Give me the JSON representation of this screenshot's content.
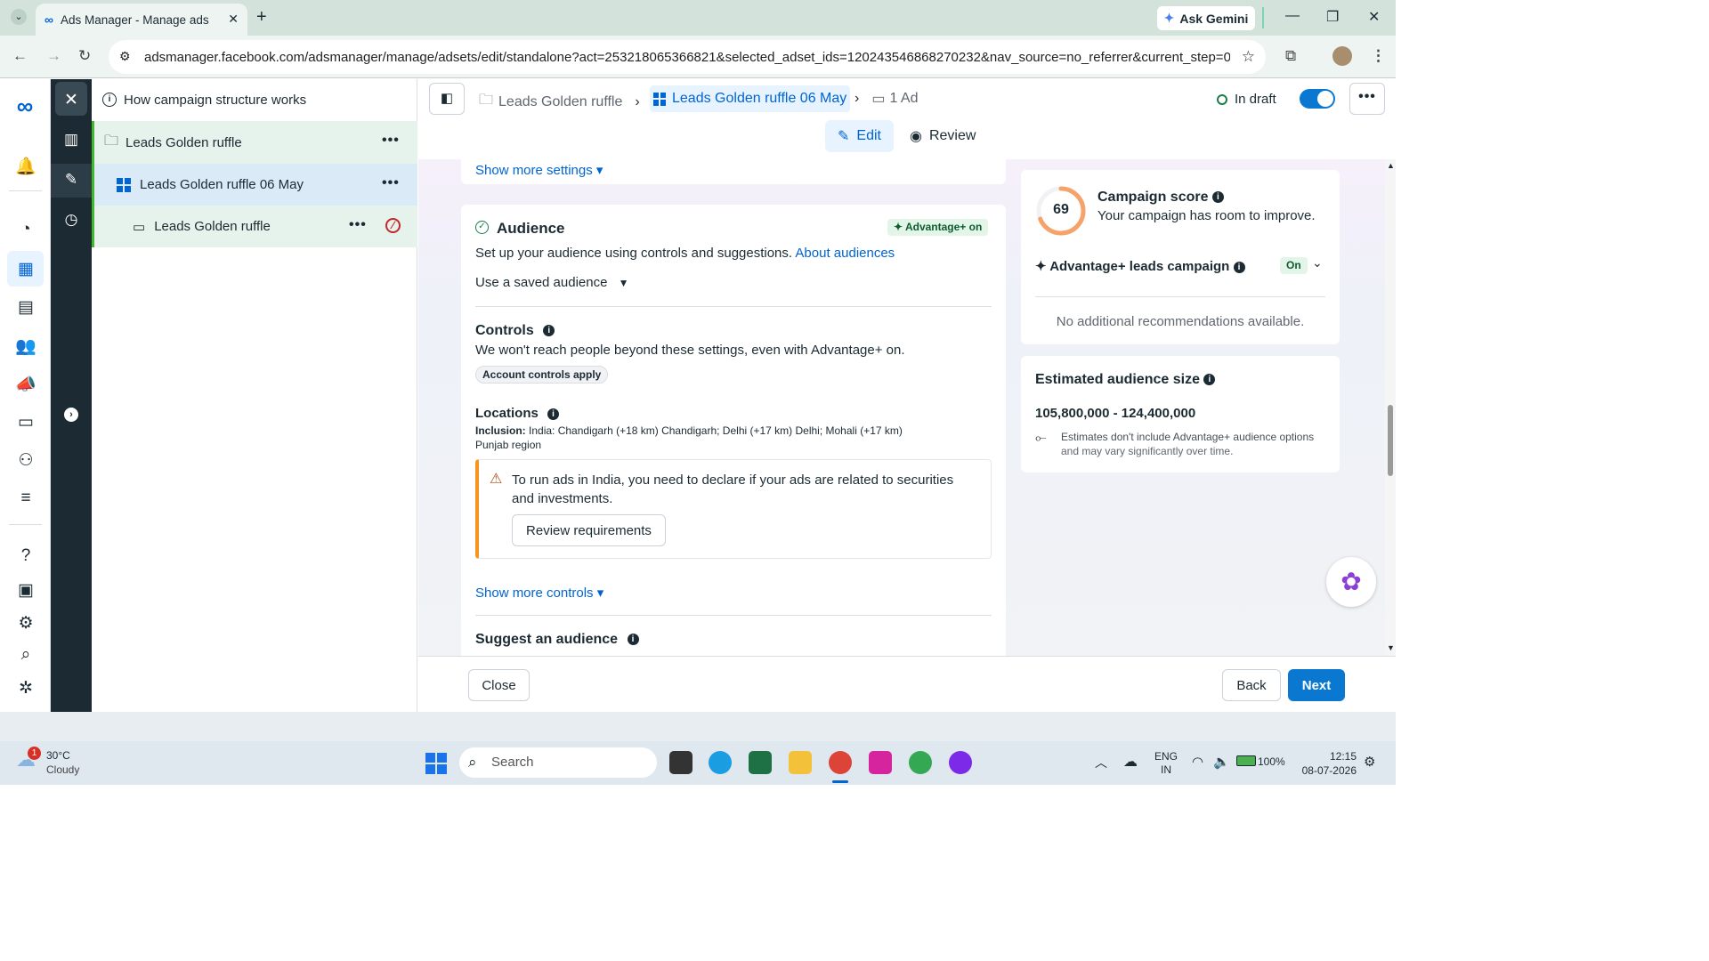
{
  "browser": {
    "tab_title": "Ads Manager - Manage ads - A",
    "ask_gemini": "Ask Gemini",
    "url": "adsmanager.facebook.com/adsmanager/manage/adsets/edit/standalone?act=253218065366821&selected_adset_ids=120243546868270232&nav_source=no_referrer&current_step=0"
  },
  "tree": {
    "header": "How campaign structure works",
    "campaign": "Leads Golden ruffle",
    "adset": "Leads Golden ruffle 06 May",
    "ad": "Leads Golden ruffle"
  },
  "topbar": {
    "crumb_campaign": "Leads Golden ruffle",
    "crumb_adset": "Leads Golden ruffle 06 May",
    "crumb_ad": "1 Ad",
    "status": "In draft",
    "edit": "Edit",
    "review": "Review"
  },
  "audience": {
    "show_more_settings": "Show more settings",
    "title": "Audience",
    "badge": "Advantage+ on",
    "desc": "Set up your audience using controls and suggestions.",
    "about_link": "About audiences",
    "saved_audience": "Use a saved audience",
    "controls_title": "Controls",
    "controls_desc": "We won't reach people beyond these settings, even with Advantage+ on.",
    "controls_chip": "Account controls apply",
    "locations_title": "Locations",
    "inclusion_label": "Inclusion:",
    "inclusion_value": "India: Chandigarh (+18 km) Chandigarh; Delhi (+17 km) Delhi; Mohali (+17 km)",
    "inclusion_line2": "Punjab region",
    "warning": "To run ads in India, you need to declare if your ads are related to securities and investments.",
    "review_requirements": "Review requirements",
    "show_more_controls": "Show more controls",
    "suggest_title": "Suggest an audience"
  },
  "score": {
    "value": "69",
    "value_fraction": 0.69,
    "title": "Campaign score",
    "subtitle": "Your campaign has room to improve.",
    "advantage_label": "Advantage+ leads campaign",
    "advantage_status": "On",
    "no_recs": "No additional recommendations available."
  },
  "estimate": {
    "title": "Estimated audience size",
    "range": "105,800,000 - 124,400,000",
    "note_bold": "Estimates don't include Advantage+ audience options",
    "note_rest": " and may vary significantly over time."
  },
  "footer": {
    "close": "Close",
    "back": "Back",
    "next": "Next"
  },
  "taskbar": {
    "temp": "30°C",
    "weather": "Cloudy",
    "weather_badge": "1",
    "search": "Search",
    "lang1": "ENG",
    "lang2": "IN",
    "battery": "100%",
    "time": "12:15",
    "date": "08-07-2026"
  },
  "colors": {
    "accent": "#0064d1",
    "rail_dark": "#1c2b33",
    "tree_selected": "#e6f2ec",
    "warning": "#f7931e",
    "score_ring": "#f5a36b",
    "advantage_badge_bg": "#e3f5e8"
  }
}
